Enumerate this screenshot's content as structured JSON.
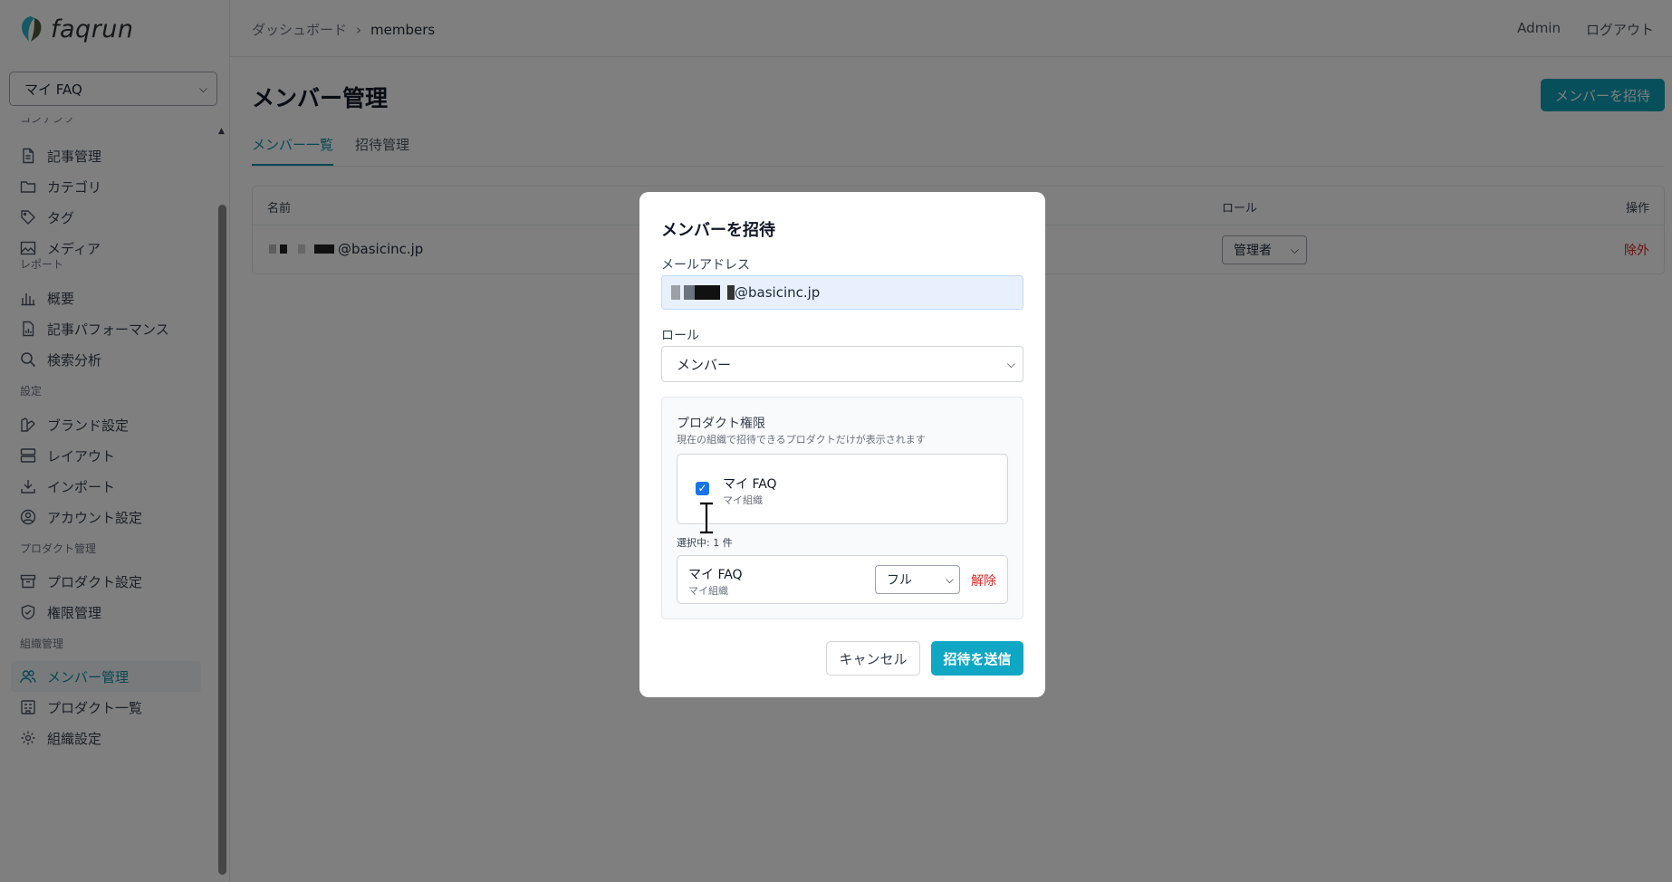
{
  "app": {
    "logo_text": "faqrun",
    "product_select": "マイ FAQ"
  },
  "sidebar": {
    "sections": [
      {
        "label": "コンテンツ"
      },
      {
        "label": "レポート"
      },
      {
        "label": "設定"
      },
      {
        "label": "プロダクト管理"
      },
      {
        "label": "組織管理"
      }
    ],
    "items": [
      {
        "label": "記事管理",
        "icon": "document-icon"
      },
      {
        "label": "カテゴリ",
        "icon": "folder-icon"
      },
      {
        "label": "タグ",
        "icon": "tag-icon"
      },
      {
        "label": "メディア",
        "icon": "image-icon"
      },
      {
        "label": "概要",
        "icon": "bar-chart-icon"
      },
      {
        "label": "記事パフォーマンス",
        "icon": "document-chart-icon"
      },
      {
        "label": "検索分析",
        "icon": "search-icon"
      },
      {
        "label": "ブランド設定",
        "icon": "palette-icon"
      },
      {
        "label": "レイアウト",
        "icon": "layout-icon"
      },
      {
        "label": "インポート",
        "icon": "download-icon"
      },
      {
        "label": "アカウント設定",
        "icon": "user-circle-icon"
      },
      {
        "label": "プロダクト設定",
        "icon": "archive-icon"
      },
      {
        "label": "権限管理",
        "icon": "shield-icon"
      },
      {
        "label": "メンバー管理",
        "icon": "users-icon",
        "active": true
      },
      {
        "label": "プロダクト一覧",
        "icon": "building-icon"
      },
      {
        "label": "組織設定",
        "icon": "gear-icon"
      }
    ]
  },
  "topbar": {
    "breadcrumb": [
      "ダッシュボード",
      "members"
    ],
    "user": "Admin",
    "logout": "ログアウト"
  },
  "main": {
    "title": "メンバー管理",
    "invite_button": "メンバーを招待",
    "tabs": [
      "メンバー一覧",
      "招待管理"
    ],
    "table": {
      "headers": [
        "名前",
        "ロール",
        "操作"
      ],
      "rows": [
        {
          "email_suffix": "@basicinc.jp",
          "role": "管理者",
          "action": "除外"
        }
      ]
    }
  },
  "modal": {
    "title": "メンバーを招待",
    "email_label": "メールアドレス",
    "email_value_suffix": "@basicinc.jp",
    "role_label": "ロール",
    "role_value": "メンバー",
    "product_perm_title": "プロダクト権限",
    "product_perm_desc": "現在の組織で招待できるプロダクトだけが表示されます",
    "option": {
      "name": "マイ FAQ",
      "org": "マイ組織",
      "checked": true
    },
    "selected_count": "選択中: 1 件",
    "selected": {
      "name": "マイ FAQ",
      "org": "マイ組織",
      "level": "フル",
      "unset": "解除"
    },
    "cancel": "キャンセル",
    "send": "招待を送信"
  },
  "colors": {
    "accent": "#0f9fb6",
    "danger": "#dc2626",
    "checkbox": "#1a73e8"
  }
}
